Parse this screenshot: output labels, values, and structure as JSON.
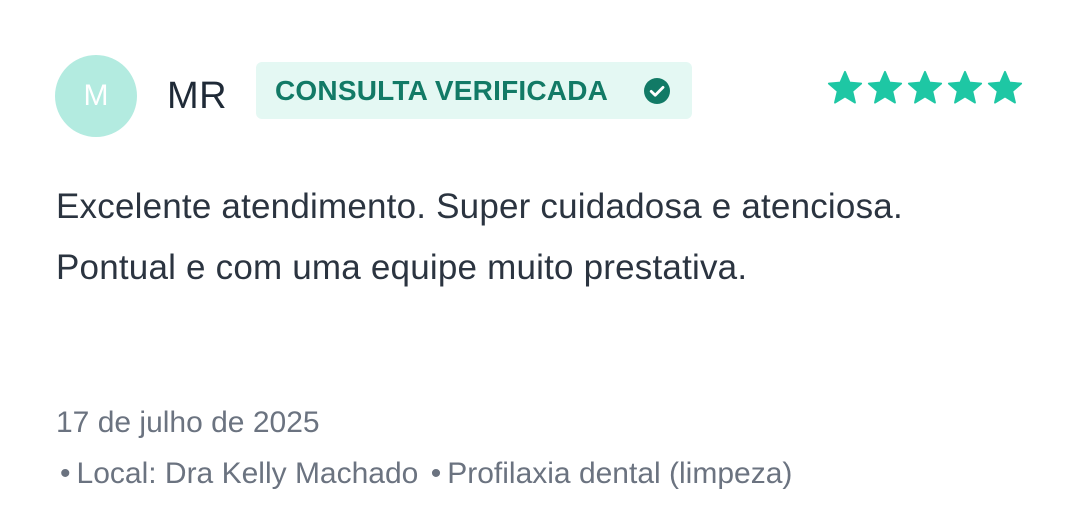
{
  "reviewer": {
    "initial": "M",
    "name": "MR"
  },
  "badge": {
    "label": "CONSULTA VERIFICADA",
    "icon": "check-circle-icon"
  },
  "rating": {
    "stars": 5,
    "max": 5,
    "color": "#1ec7a4"
  },
  "review": {
    "text": "Excelente atendimento. Super cuidadosa e atenciosa. Pontual e com uma equipe muito prestativa.",
    "date": "17 de julho de 2025"
  },
  "meta": {
    "bullet": "•",
    "location": "Local: Dra Kelly Machado",
    "service": "Profilaxia dental (limpeza)"
  },
  "colors": {
    "avatar_bg": "#b3ebe0",
    "badge_bg": "#e4f8f3",
    "badge_text": "#127a66",
    "star": "#1ec7a4"
  }
}
